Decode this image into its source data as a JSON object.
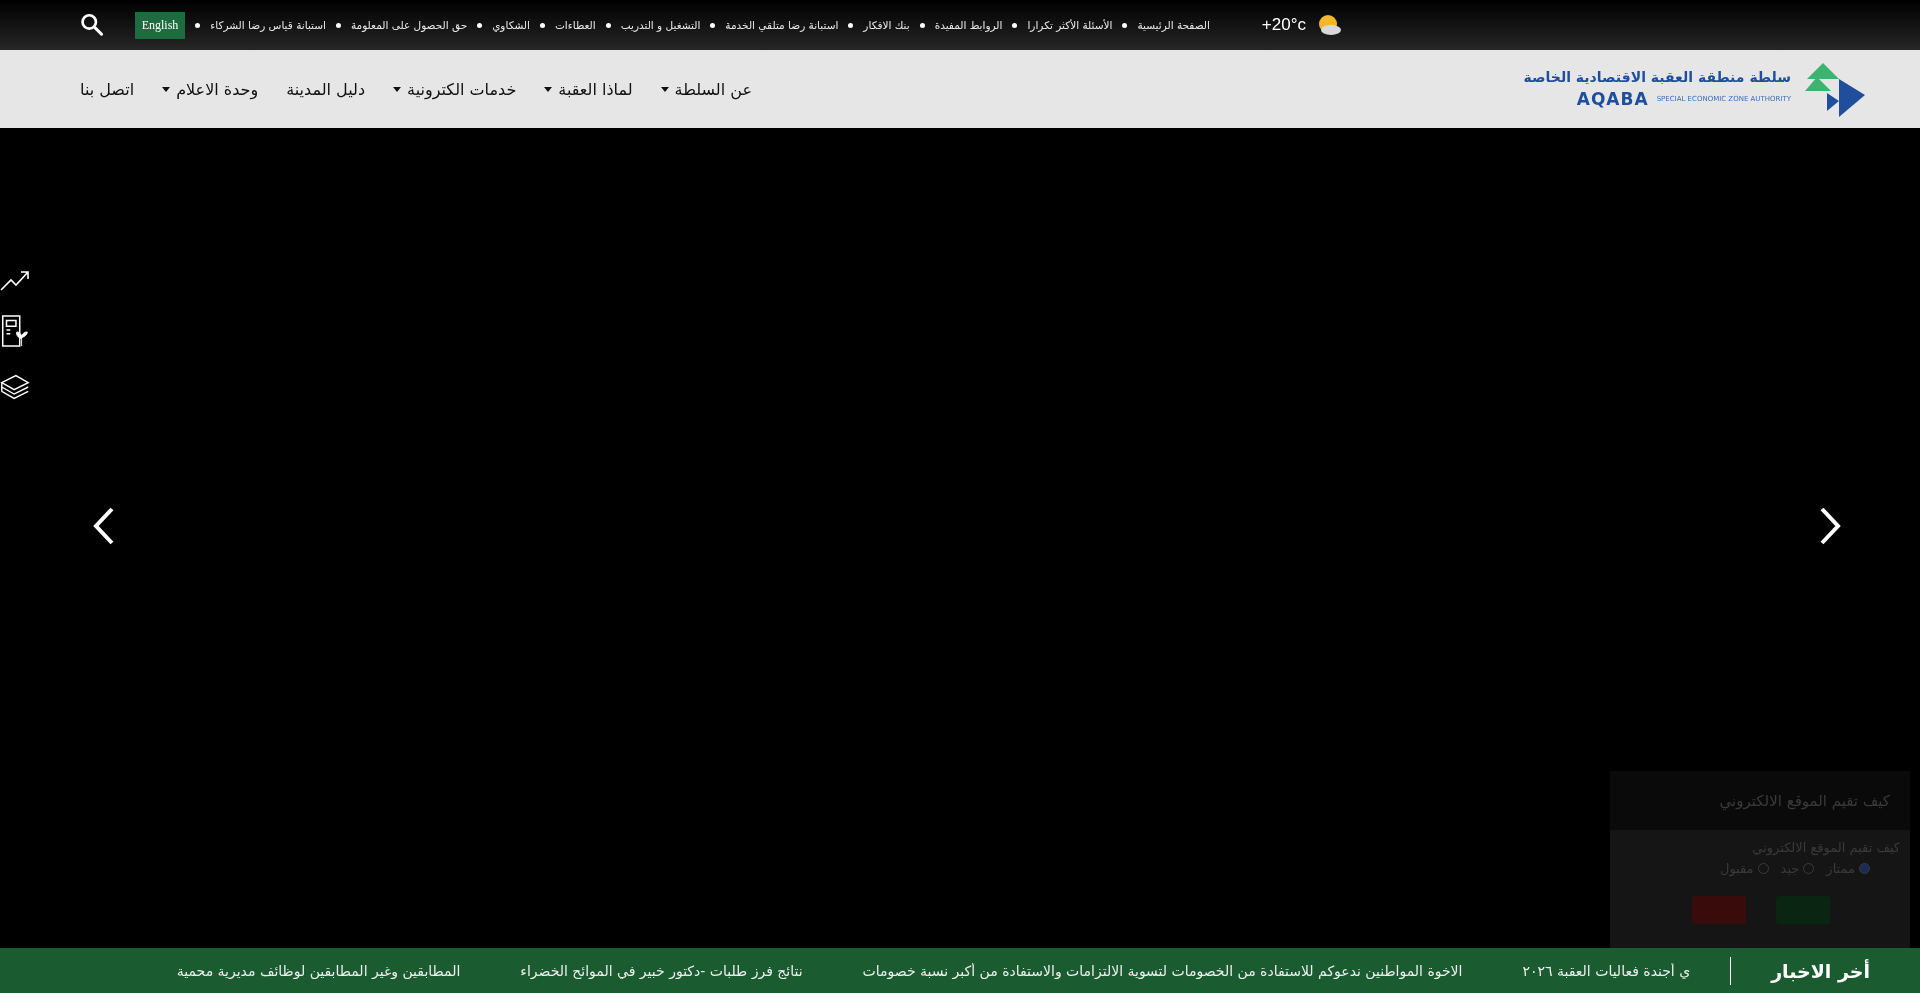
{
  "top_bar": {
    "weather": {
      "temperature": "+20°c"
    },
    "links": [
      "الصفحة الرئيسية",
      "الأسئلة الأكثر تكرارا",
      "الروابط المفيدة",
      "بنك الافكار",
      "استبانة رضا متلقي الخدمة",
      "التشغيل و التدريب",
      "العطاءات",
      "الشكاوي",
      "حق الحصول على المعلومة",
      "استبانة قياس رضا الشركاء"
    ],
    "language_button": "English"
  },
  "header": {
    "logo": {
      "arabic_name": "سلطة منطقة العقبة الاقتصادية الخاصة",
      "latin_name": "AQABA",
      "subtitle": "SPECIAL ECONOMIC ZONE AUTHORITY"
    },
    "nav": [
      {
        "label": "عن السلطة",
        "dropdown": true
      },
      {
        "label": "لماذا العقبة",
        "dropdown": true
      },
      {
        "label": "خدمات الكترونية",
        "dropdown": true
      },
      {
        "label": "دليل المدينة",
        "dropdown": false
      },
      {
        "label": "وحدة الاعلام",
        "dropdown": true
      },
      {
        "label": "اتصل بنا",
        "dropdown": false
      }
    ]
  },
  "poll": {
    "title": "كيف تقيم الموقع الالكتروني",
    "question": "كيف تقيم الموقع الالكتروني",
    "options": [
      {
        "label": "ممتاز",
        "selected": true
      },
      {
        "label": "جيد",
        "selected": false
      },
      {
        "label": "مقبول",
        "selected": false
      }
    ]
  },
  "news_ticker": {
    "label": "أخر الاخبار",
    "items": [
      "ي أجندة فعاليات العقبة ٢٠٢٦",
      "الاخوة المواطنين ندعوكم للاستفادة من الخصومات لتسوية الالتزامات والاستفادة من أكبر نسبة خصومات",
      "نتائج فرز طلبات -دكتور خبير في الموائح الخضراء",
      "المطابقين وغير المطابقين لوظائف مديرية محمية"
    ]
  }
}
